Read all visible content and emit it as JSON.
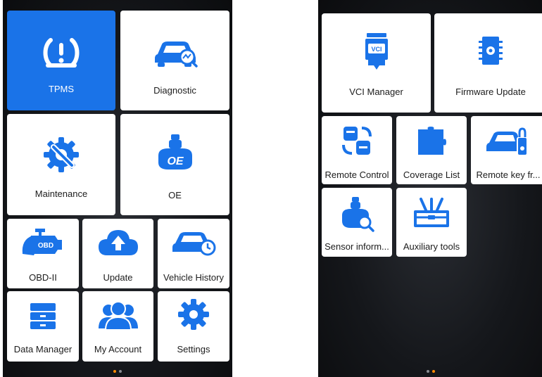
{
  "colors": {
    "accent": "#1a73e8",
    "tile": "#ffffff",
    "page_dot_active": "#ff8a00"
  },
  "left_screen": {
    "tiles": [
      {
        "label": "TPMS",
        "icon": "tpms-icon",
        "selected": true
      },
      {
        "label": "Diagnostic",
        "icon": "car-diagnostic-icon"
      },
      {
        "label": "Maintenance",
        "icon": "gear-wrench-icon"
      },
      {
        "label": "OE",
        "icon": "oe-sensor-icon"
      },
      {
        "label": "OBD-II",
        "icon": "engine-obd-icon"
      },
      {
        "label": "Update",
        "icon": "cloud-upload-icon"
      },
      {
        "label": "Vehicle History",
        "icon": "car-clock-icon"
      },
      {
        "label": "Data Manager",
        "icon": "drawer-cabinet-icon"
      },
      {
        "label": "My Account",
        "icon": "users-icon"
      },
      {
        "label": "Settings",
        "icon": "settings-gear-icon"
      }
    ]
  },
  "right_screen": {
    "tiles": [
      {
        "label": "VCI Manager",
        "icon": "vci-device-icon"
      },
      {
        "label": "Firmware Update",
        "icon": "chip-icon"
      },
      {
        "label": "Remote Control",
        "icon": "remote-control-icon"
      },
      {
        "label": "Coverage List",
        "icon": "puzzle-icon"
      },
      {
        "label": "Remote key fr...",
        "icon": "car-key-icon"
      },
      {
        "label": "Sensor inform...",
        "icon": "sensor-search-icon"
      },
      {
        "label": "Auxiliary tools",
        "icon": "toolbox-icon"
      }
    ]
  }
}
